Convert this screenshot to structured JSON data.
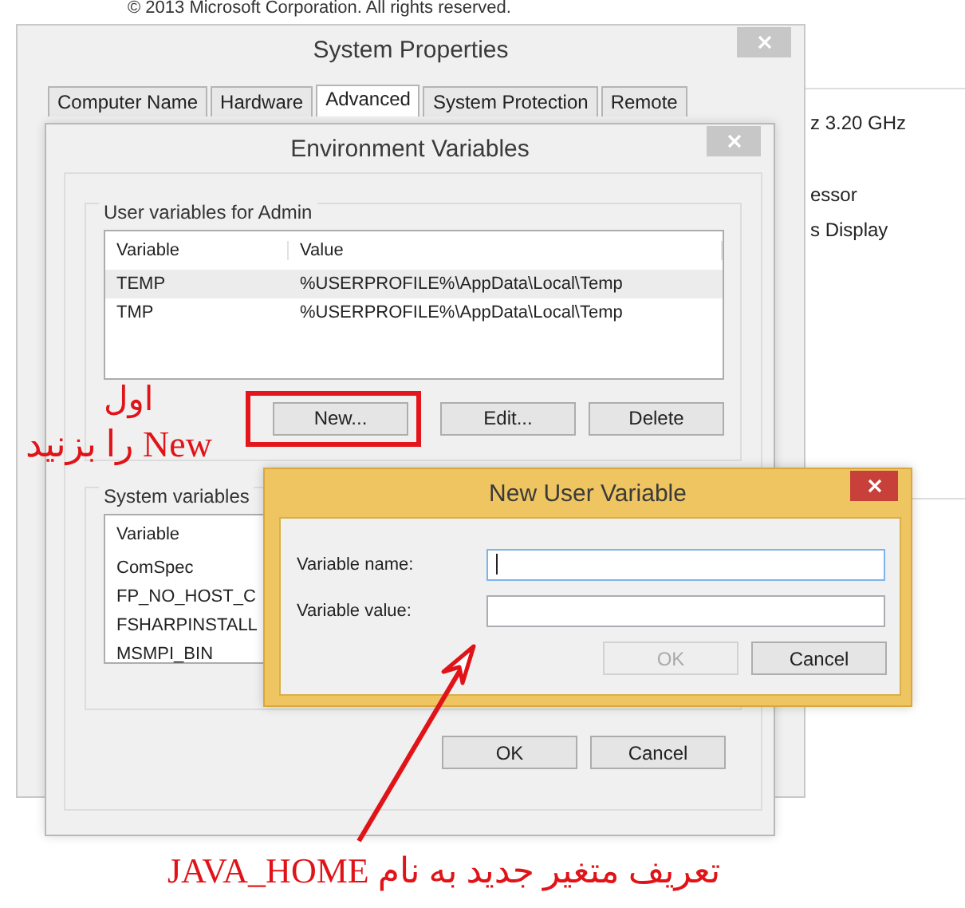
{
  "background": {
    "copyright": "© 2013 Microsoft Corporation. All rights reserved.",
    "info_lines": [
      "z  3.20 GHz",
      "essor",
      "s Display"
    ]
  },
  "system_properties": {
    "title": "System Properties",
    "tabs": [
      {
        "label": "Computer Name",
        "selected": false
      },
      {
        "label": "Hardware",
        "selected": false
      },
      {
        "label": "Advanced",
        "selected": true
      },
      {
        "label": "System Protection",
        "selected": false
      },
      {
        "label": "Remote",
        "selected": false
      }
    ]
  },
  "environment_variables": {
    "title": "Environment Variables",
    "user_group": {
      "title": "User variables for Admin",
      "columns": [
        "Variable",
        "Value"
      ],
      "rows": [
        {
          "variable": "TEMP",
          "value": "%USERPROFILE%\\AppData\\Local\\Temp",
          "selected": true
        },
        {
          "variable": "TMP",
          "value": "%USERPROFILE%\\AppData\\Local\\Temp",
          "selected": false
        }
      ],
      "buttons": [
        {
          "label": "New...",
          "highlighted": true
        },
        {
          "label": "Edit...",
          "highlighted": false
        },
        {
          "label": "Delete",
          "highlighted": false
        }
      ]
    },
    "system_group": {
      "title": "System variables",
      "columns": [
        "Variable"
      ],
      "rows": [
        {
          "variable": "ComSpec",
          "selected": false
        },
        {
          "variable": "FP_NO_HOST_C",
          "selected": false
        },
        {
          "variable": "FSHARPINSTALL",
          "selected": false
        },
        {
          "variable": "MSMPI_BIN",
          "selected": false
        }
      ]
    },
    "buttons": [
      "OK",
      "Cancel"
    ]
  },
  "new_user_variable": {
    "title": "New User Variable",
    "fields": [
      {
        "label": "Variable name:",
        "focused": true
      },
      {
        "label": "Variable value:",
        "focused": false
      }
    ],
    "buttons": [
      {
        "label": "OK",
        "disabled": true
      },
      {
        "label": "Cancel",
        "disabled": false
      }
    ]
  },
  "annotations": {
    "step_lines": [
      "اول",
      "New را بزنید"
    ],
    "caption": "تعریف متغیر جدید به نام JAVA_HOME"
  }
}
